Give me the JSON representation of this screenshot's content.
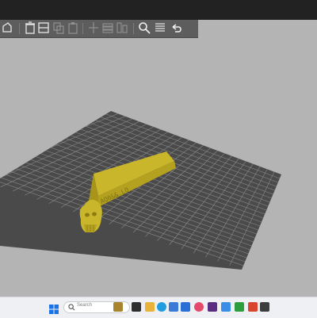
{
  "window": {
    "title_bar_color": "#222222"
  },
  "toolbar": {
    "buttons": [
      {
        "name": "add-plate-icon",
        "enabled": true
      },
      {
        "name": "delete-icon",
        "enabled": true
      },
      {
        "name": "arrange-icon",
        "enabled": true
      },
      {
        "name": "copy-icon",
        "enabled": false
      },
      {
        "name": "paste-icon",
        "enabled": false
      },
      {
        "name": "split-icon",
        "enabled": false
      },
      {
        "name": "layers-icon",
        "enabled": false
      },
      {
        "name": "variable-layer-icon",
        "enabled": false
      },
      {
        "name": "search-icon",
        "enabled": true
      },
      {
        "name": "list-icon",
        "enabled": true
      },
      {
        "name": "undo-icon",
        "enabled": true
      }
    ]
  },
  "viewport": {
    "background_color": "#b4b4b4",
    "bed_color": "#4a4a4a",
    "model_color": "#c9b62b",
    "model_engraving": "AQ0&&.LO"
  },
  "taskbar": {
    "search_placeholder": "Search",
    "apps": [
      "windows-start-icon",
      "search-icon",
      "widgets-icon",
      "task-view-icon",
      "file-explorer-icon",
      "edge-browser-icon",
      "store-icon",
      "photos-icon",
      "app-icon",
      "xbox-icon",
      "slicer-app-icon",
      "terminal-icon"
    ]
  }
}
